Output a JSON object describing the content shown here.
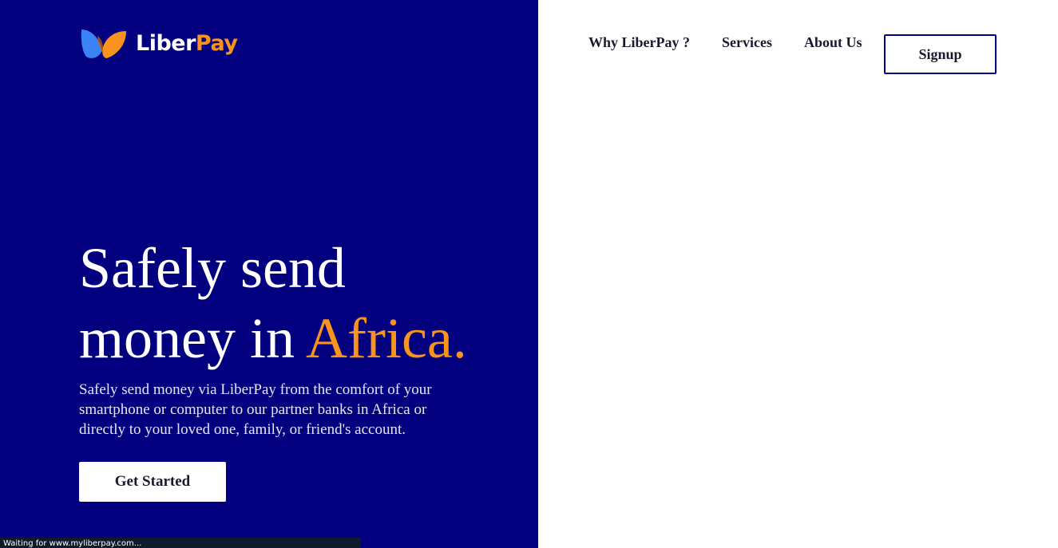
{
  "brand": {
    "name_part1": "Liber",
    "name_part2": "Pay",
    "logo_icon": "butterfly-logo-icon",
    "colors": {
      "primary_navy": "#02007e",
      "accent_orange": "#f7931e",
      "logo_blue": "#3b82f6"
    }
  },
  "nav": {
    "items": [
      {
        "label": "Why LiberPay ?"
      },
      {
        "label": "Services"
      },
      {
        "label": "About Us"
      }
    ],
    "signup_label": "Signup"
  },
  "hero": {
    "headline_line1": "Safely send",
    "headline_line2_prefix": "money in ",
    "headline_accent": "Africa.",
    "description": "Safely send money via LiberPay from the comfort of your smartphone or computer to our partner banks in Africa or directly to your loved one, family, or friend's account.",
    "cta_label": "Get Started"
  },
  "browser_status": {
    "text": "Waiting for www.myliberpay.com..."
  }
}
